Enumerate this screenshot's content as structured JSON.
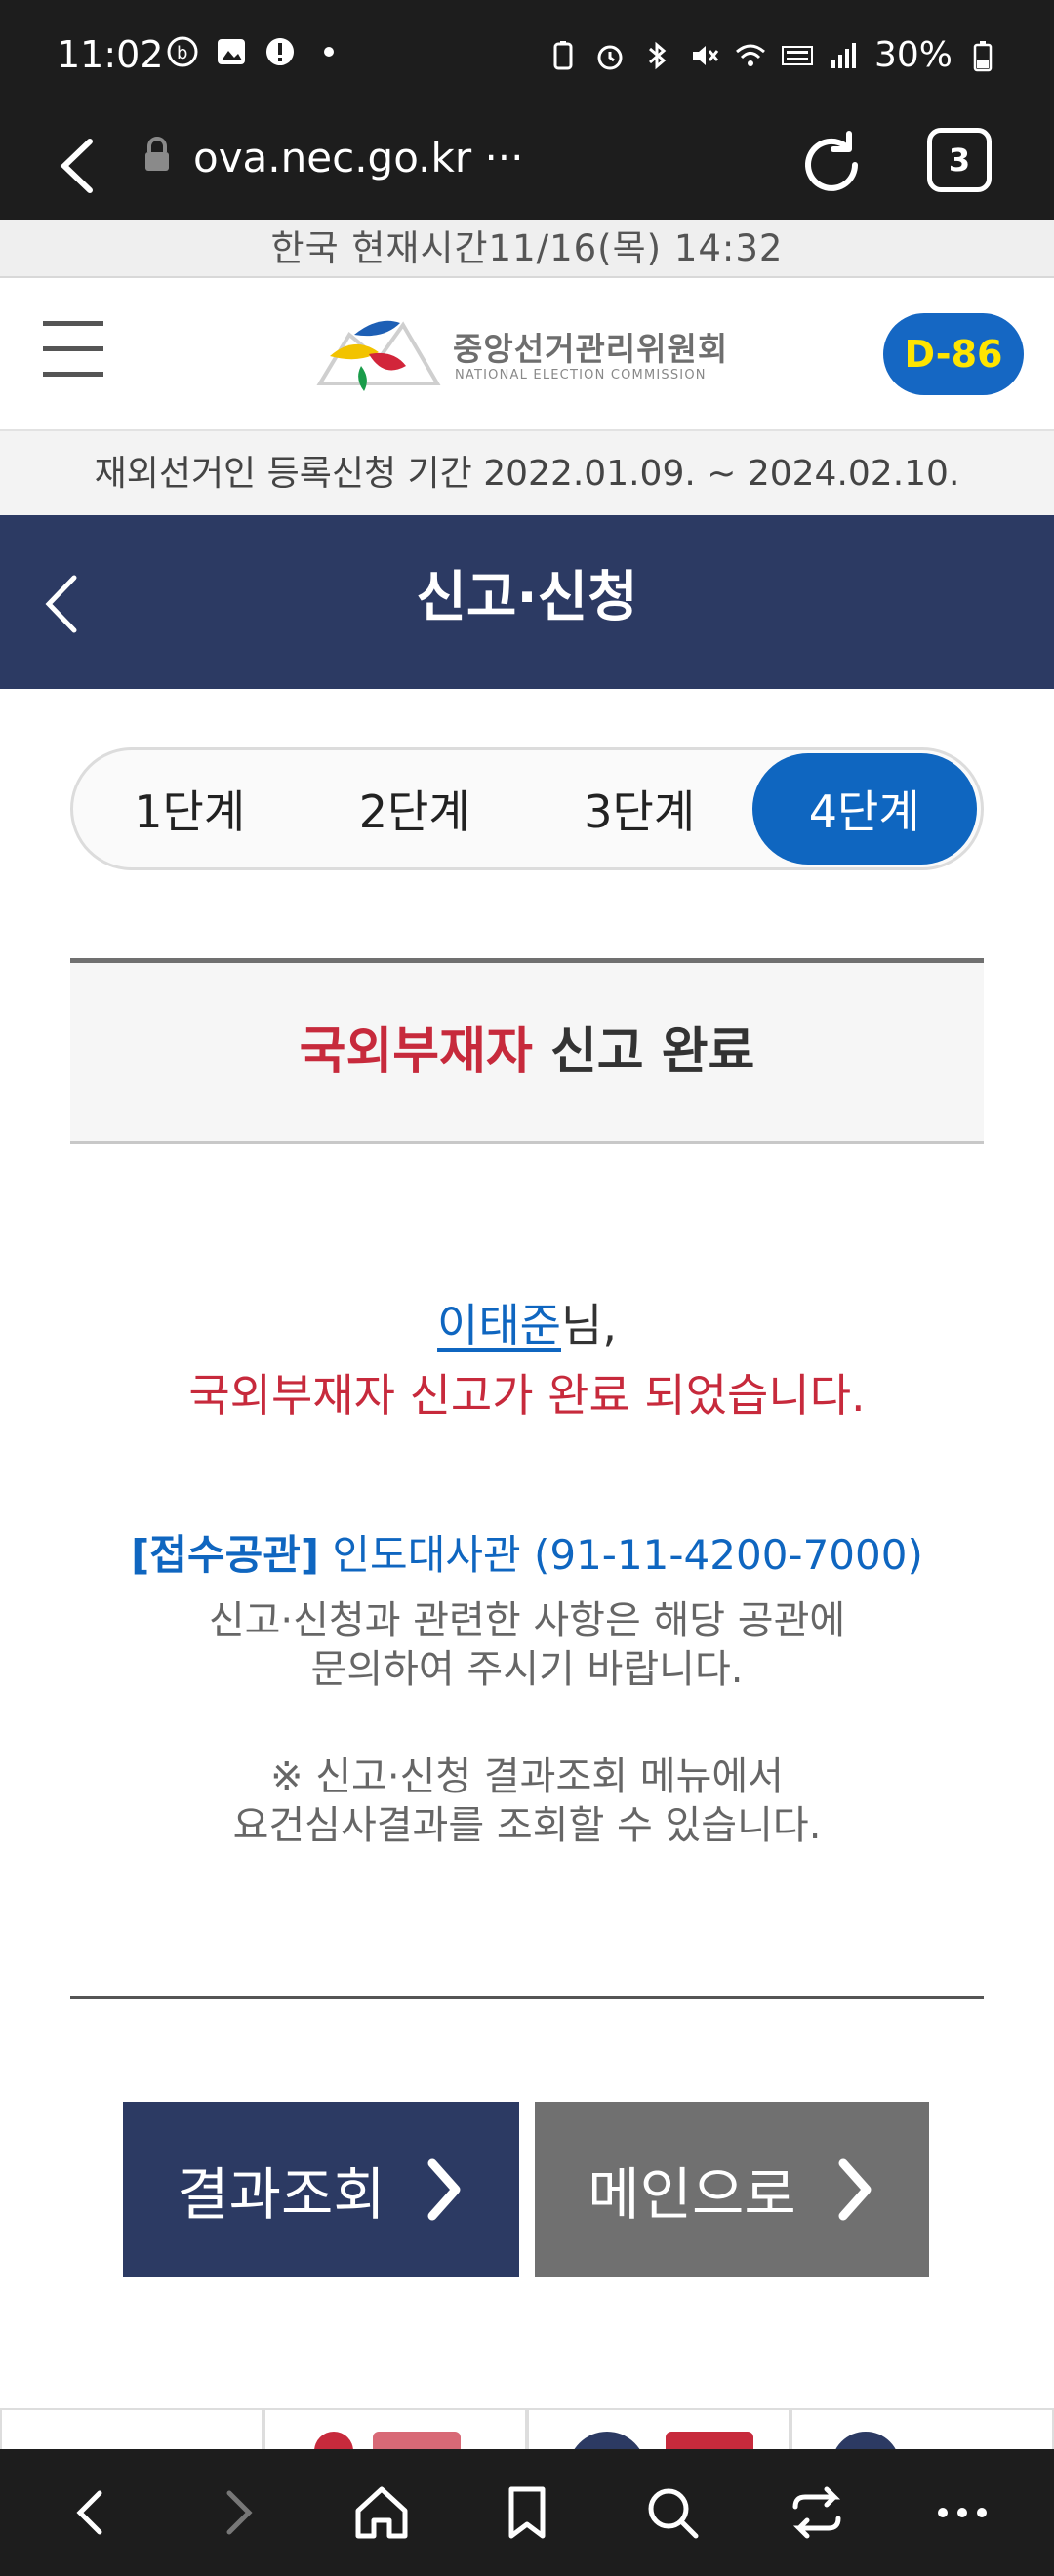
{
  "status_bar": {
    "time": "11:02",
    "battery": "30%",
    "icons": [
      "b-app-icon",
      "image-icon",
      "alert-icon",
      "dot-icon",
      "battery-saver-icon",
      "alarm-icon",
      "bluetooth-icon",
      "mute-icon",
      "wifi-icon",
      "volte-lte-icon",
      "signal-icon",
      "battery-icon"
    ]
  },
  "browser": {
    "url": "ova.nec.go.kr ···",
    "tab_count": "3"
  },
  "korea_time": "한국 현재시간11/16(목) 14:32",
  "header": {
    "logo_title": "중앙선거관리위원회",
    "logo_subtitle": "NATIONAL ELECTION COMMISSION",
    "dday": "D-86"
  },
  "period": "재외선거인 등록신청 기간 2022.01.09. ~ 2024.02.10.",
  "page_title": "신고·신청",
  "steps": [
    {
      "label": "1단계",
      "active": false
    },
    {
      "label": "2단계",
      "active": false
    },
    {
      "label": "3단계",
      "active": false
    },
    {
      "label": "4단계",
      "active": true
    }
  ],
  "result": {
    "title_highlight": "국외부재자",
    "title_rest": " 신고 완료",
    "name": "이태준",
    "name_suffix": "님,",
    "done_message": "국외부재자 신고가 완료 되었습니다.",
    "office_label": "[접수공관]",
    "office_value": " 인도대사관 (91-11-4200-7000)",
    "info_line1": "신고·신청과 관련한 사항은 해당 공관에",
    "info_line2": "문의하여 주시기 바랍니다.",
    "note_line1": "※ 신고·신청 결과조회 메뉴에서",
    "note_line2": "요건심사결과를 조회할 수 있습니다."
  },
  "buttons": {
    "result_label": "결과조회",
    "main_label": "메인으로"
  },
  "colors": {
    "navy": "#2c3a63",
    "blue": "#0f66c0",
    "red": "#c72a3c",
    "gray_button": "#707070",
    "dday_text": "#ffe500"
  }
}
